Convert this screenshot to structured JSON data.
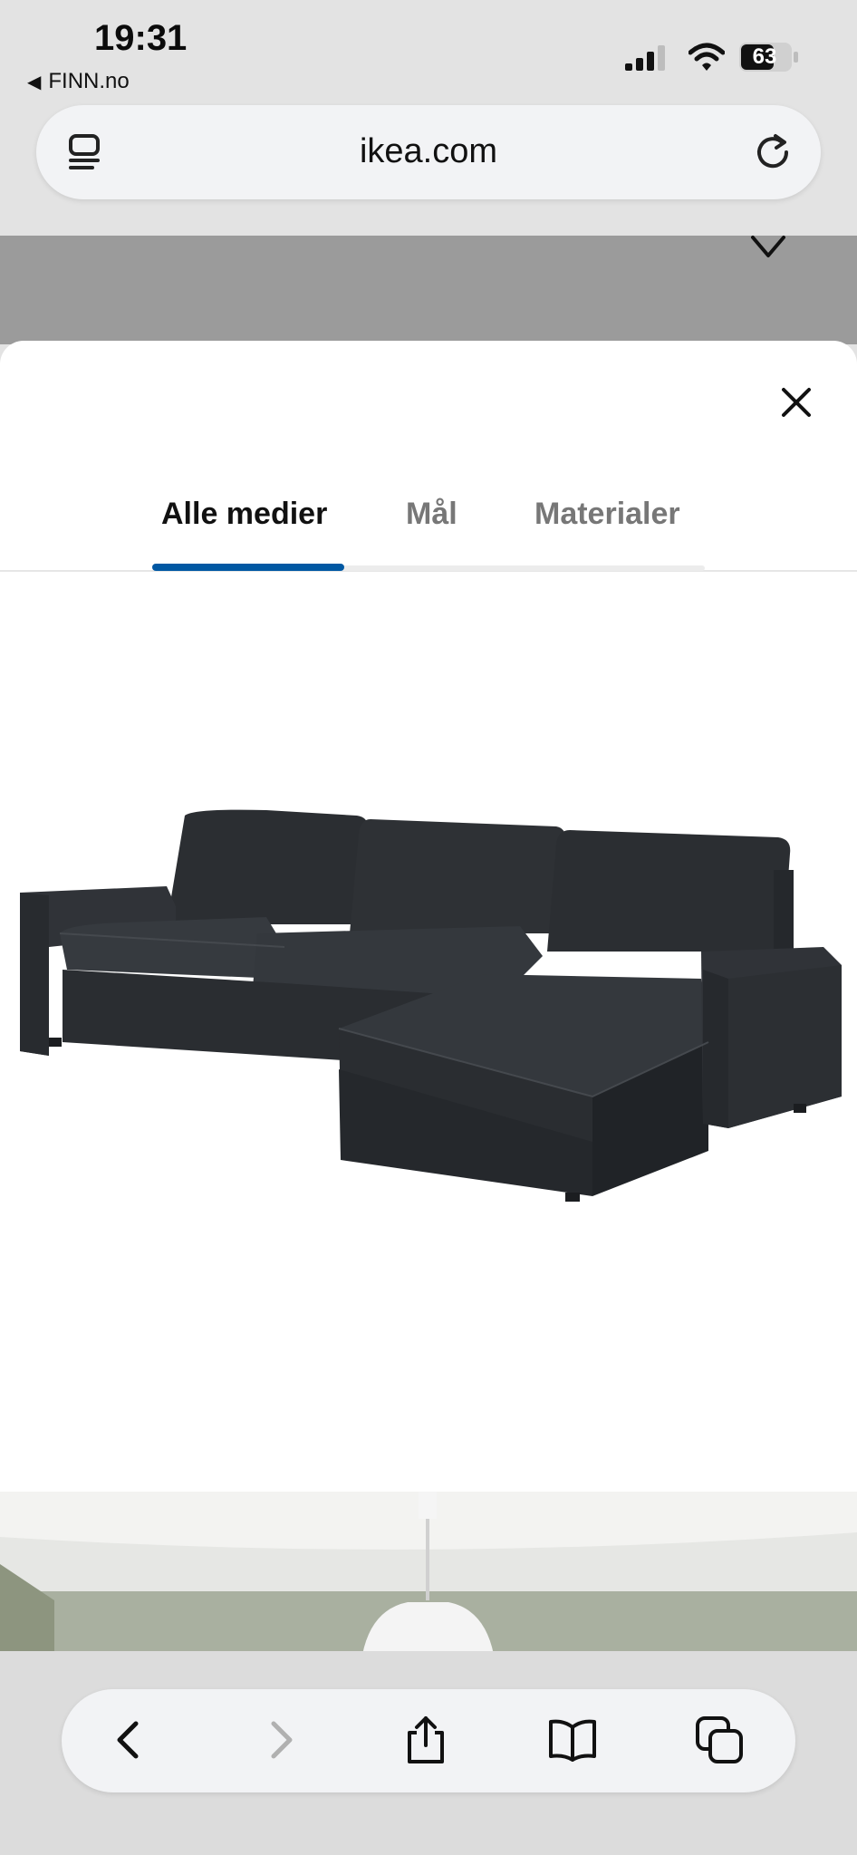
{
  "status_bar": {
    "time": "19:31",
    "back_app": "FINN.no",
    "battery": "63"
  },
  "address_bar": {
    "url": "ikea.com"
  },
  "modal": {
    "tabs": [
      "Alle medier",
      "Mål",
      "Materialer"
    ],
    "active_tab": "Alle medier"
  },
  "colors": {
    "active_tab_indicator": "#0058a3",
    "sofa_fabric": "#2f3236"
  },
  "icons": {
    "reader": "reader-icon",
    "reload": "reload-icon",
    "heart": "heart-icon",
    "close": "close-icon",
    "back": "chevron-left-icon",
    "forward": "chevron-right-icon",
    "share": "share-icon",
    "bookmarks": "book-icon",
    "tabs": "tabs-icon"
  }
}
